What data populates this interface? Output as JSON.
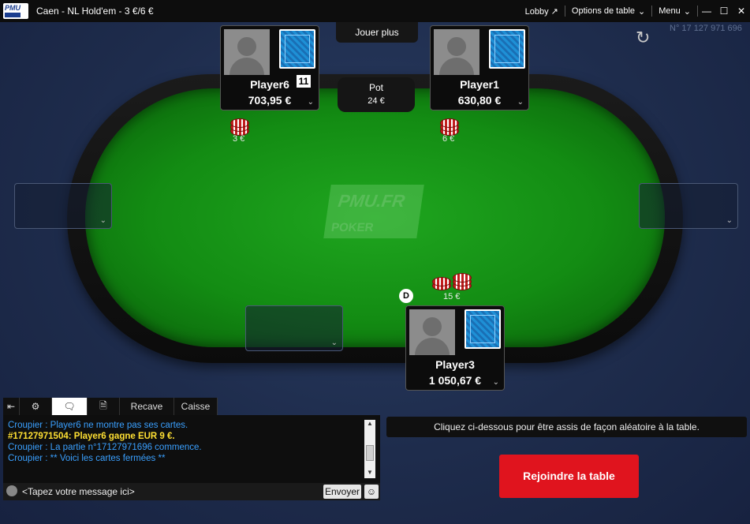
{
  "window": {
    "title": "Caen -  NL Hold'em - 3 €/6 €",
    "logo_text": "PMU",
    "menu": {
      "lobby": "Lobby ↗",
      "table_options": "Options de table",
      "menu": "Menu"
    },
    "controls": {
      "minimize": "—",
      "maximize": "☐",
      "close": "✕"
    }
  },
  "table": {
    "play_more": "Jouer plus",
    "number": "N° 17 127 971 696",
    "pot": {
      "label": "Pot",
      "value": "24 €"
    },
    "felt_logo": {
      "brand": "PMU.FR",
      "product": "POKER"
    },
    "dealer_button": "D"
  },
  "players": [
    {
      "name": "Player6",
      "stack": "703,95 €",
      "timer": "11",
      "bet": "3 €"
    },
    {
      "name": "Player1",
      "stack": "630,80 €",
      "bet": "6 €"
    },
    {
      "name": "Player3",
      "stack": "1 050,67 €",
      "bet": "15 €"
    }
  ],
  "chat": {
    "tabs": [
      "Recave",
      "Caisse"
    ],
    "messages": [
      {
        "text": "Croupier : Player6 ne montre pas ses cartes."
      },
      {
        "text": "#17127971504: Player6 gagne EUR 9 €."
      },
      {
        "text": "Croupier : La partie n°17127971696 commence."
      },
      {
        "text": "Croupier : ** Voici les cartes fermées **"
      }
    ],
    "placeholder": "<Tapez votre message ici>",
    "send": "Envoyer"
  },
  "seat_info": "Cliquez ci-dessous pour être assis de façon aléatoire à la table.",
  "join_button": "Rejoindre la table",
  "colors": {
    "accent": "#e0141e",
    "felt": "#138c13",
    "chat_dealer": "#3aa0ff",
    "chat_win": "#ffe033"
  }
}
